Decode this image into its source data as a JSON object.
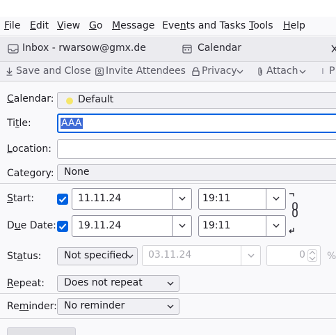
{
  "menubar": {
    "items": [
      "File",
      "Edit",
      "View",
      "Go",
      "Message",
      "Events and Tasks",
      "Tools",
      "Help"
    ]
  },
  "tabs": [
    {
      "label": "Inbox - rwarsow@gmx.de",
      "icon": "inbox-icon"
    },
    {
      "label": "Calendar",
      "icon": "calendar-icon"
    }
  ],
  "toolbar": {
    "save_close": "Save and Close",
    "invite": "Invite Attendees",
    "privacy": "Privacy",
    "attach": "Attach",
    "overflow": "P"
  },
  "form": {
    "calendar_label": "Calendar:",
    "calendar_value": "Default",
    "calendar_color": "#f5e66b",
    "title_label": "Title:",
    "title_value": "AAA",
    "location_label": "Location:",
    "location_value": "",
    "category_label": "Category:",
    "category_value": "None",
    "start_label": "Start:",
    "start_date": "11.11.24",
    "start_time": "19:11",
    "due_label": "Due Date:",
    "due_date": "19.11.24",
    "due_time": "19:11",
    "status_label": "Status:",
    "status_value": "Not specified",
    "status_date": "03.11.24",
    "percent_value": "0",
    "percent_sign": "%",
    "repeat_label": "Repeat:",
    "repeat_value": "Does not repeat",
    "reminder_label": "Reminder:",
    "reminder_value": "No reminder"
  },
  "colors": {
    "accent": "#0061e0",
    "selection": "#3d6ad6"
  }
}
